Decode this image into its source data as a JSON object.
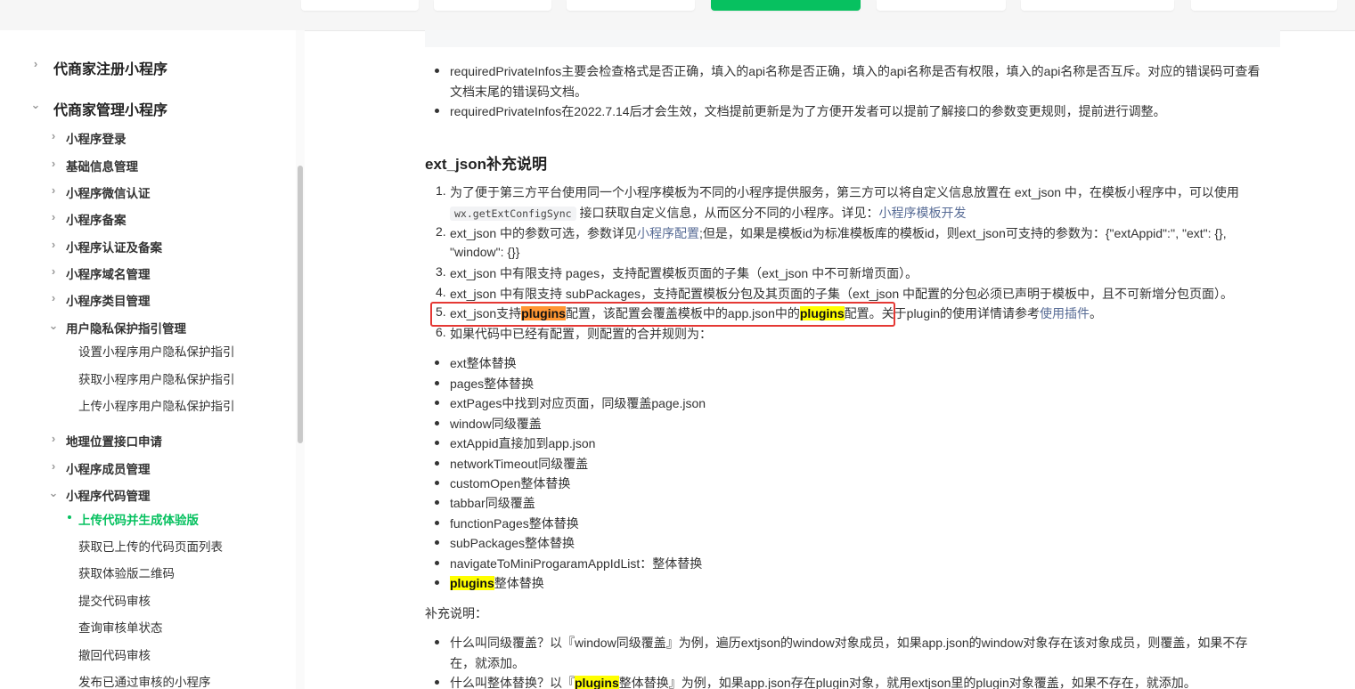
{
  "sidebar": {
    "items": [
      {
        "label": "代商家注册小程序",
        "level": 1,
        "state": "collapsed"
      },
      {
        "label": "代商家管理小程序",
        "level": 1,
        "state": "expanded"
      },
      {
        "label": "小程序登录",
        "level": 2,
        "state": "collapsed"
      },
      {
        "label": "基础信息管理",
        "level": 2,
        "state": "collapsed"
      },
      {
        "label": "小程序微信认证",
        "level": 2,
        "state": "collapsed"
      },
      {
        "label": "小程序备案",
        "level": 2,
        "state": "collapsed"
      },
      {
        "label": "小程序认证及备案",
        "level": 2,
        "state": "collapsed"
      },
      {
        "label": "小程序域名管理",
        "level": 2,
        "state": "collapsed"
      },
      {
        "label": "小程序类目管理",
        "level": 2,
        "state": "collapsed"
      },
      {
        "label": "用户隐私保护指引管理",
        "level": 2,
        "state": "expanded"
      },
      {
        "label": "设置小程序用户隐私保护指引",
        "level": 3
      },
      {
        "label": "获取小程序用户隐私保护指引",
        "level": 3
      },
      {
        "label": "上传小程序用户隐私保护指引",
        "level": 3
      },
      {
        "label": "地理位置接口申请",
        "level": 2,
        "state": "collapsed"
      },
      {
        "label": "小程序成员管理",
        "level": 2,
        "state": "collapsed"
      },
      {
        "label": "小程序代码管理",
        "level": 2,
        "state": "expanded"
      },
      {
        "label": "上传代码并生成体验版",
        "level": 3,
        "active": true
      },
      {
        "label": "获取已上传的代码页面列表",
        "level": 3
      },
      {
        "label": "获取体验版二维码",
        "level": 3
      },
      {
        "label": "提交代码审核",
        "level": 3
      },
      {
        "label": "查询审核单状态",
        "level": 3
      },
      {
        "label": "撤回代码审核",
        "level": 3
      },
      {
        "label": "发布已通过审核的小程序",
        "level": 3
      }
    ]
  },
  "main": {
    "notes": {
      "b1_line1": "requiredPrivateInfos主要会检查格式是否正确，填入的api名称是否正确，填入的api名称是否有权限，填入的api名称是否互斥。对应的错误码可查看",
      "b1_line2": "文档末尾的错误码文档。",
      "b2": "requiredPrivateInfos在2022.7.14后才会生效，文档提前更新是为了方便开发者可以提前了解接口的参数变更规则，提前进行调整。"
    },
    "section_title": "ext_json补充说明",
    "ol": {
      "i1_num": "1.",
      "i1_line1": "为了便于第三方平台使用同一个小程序模板为不同的小程序提供服务，第三方可以将自定义信息放置在 ext_json 中，在模板小程序中，可以使用",
      "i1_code": "wx.getExtConfigSync",
      "i1_mid": " 接口获取自定义信息，从而区分不同的小程序。详见：",
      "i1_link": "小程序模板开发",
      "i2_num": "2.",
      "i2_pre": "ext_json 中的参数可选，参数详见",
      "i2_link": "小程序配置",
      "i2_post": ";但是，如果是模板id为标准模板库的模板id，则ext_json可支持的参数为：{\"extAppid\":'', \"ext\": {},",
      "i2_line2": "\"window\": {}}",
      "i3_num": "3.",
      "i3": "ext_json 中有限支持 pages，支持配置模板页面的子集（ext_json 中不可新增页面）。",
      "i4_num": "4.",
      "i4": "ext_json 中有限支持 subPackages，支持配置模板分包及其页面的子集（ext_json 中配置的分包必须已声明于模板中，且不可新增分包页面）。",
      "i5_num": "5.",
      "i5_a": "ext_json支持",
      "i5_hl1": "plugins",
      "i5_b": "配置，该配置会覆盖模板中的app.json中的",
      "i5_hl2": "plugins",
      "i5_c": "配置。关于plugin的使用详情请参考",
      "i5_link": "使用插件",
      "i5_d": "。",
      "i6_num": "6.",
      "i6": "如果代码中已经有配置，则配置的合并规则为："
    },
    "rules": [
      "ext整体替换",
      "pages整体替换",
      "extPages中找到对应页面，同级覆盖page.json",
      "window同级覆盖",
      "extAppid直接加到app.json",
      "networkTimeout同级覆盖",
      "customOpen整体替换",
      "tabbar同级覆盖",
      "functionPages整体替换",
      "subPackages整体替换",
      "navigateToMiniProgaramAppIdList：整体替换"
    ],
    "rule_last_hl": "plugins",
    "rule_last_rest": "整体替换",
    "supplement_title": "补充说明：",
    "supp": {
      "s1_line1": "什么叫同级覆盖？以『window同级覆盖』为例，遍历extjson的window对象成员，如果app.json的window对象存在该对象成员，则覆盖，如果不存",
      "s1_line2": "在，就添加。",
      "s2_pre": "什么叫整体替换？以『",
      "s2_hl": "plugins",
      "s2_post": "整体替换』为例，如果app.json存在plugin对象，就用extjson里的plugin对象覆盖，如果不存在，就添加。"
    }
  },
  "colors": {
    "accent": "#07c160",
    "link": "#576b95",
    "highlight": "#ffff00",
    "highlight_current": "#ff9632",
    "annotation_box": "#e53935"
  }
}
